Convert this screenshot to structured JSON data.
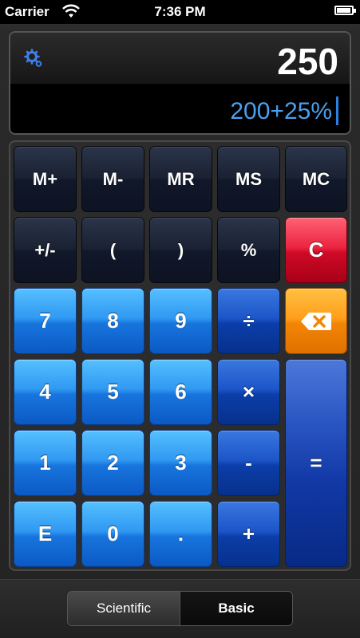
{
  "status_bar": {
    "carrier": "Carrier",
    "time": "7:36 PM",
    "wifi_icon": "wifi-icon",
    "battery_icon": "battery-icon",
    "battery_level": 0.95
  },
  "display": {
    "settings_icon": "gear-icon",
    "result": "250",
    "expression": "200+25%"
  },
  "keys": {
    "m_plus": "M+",
    "m_minus": "M-",
    "mr": "MR",
    "ms": "MS",
    "mc": "MC",
    "plus_minus": "+/-",
    "paren_open": "(",
    "paren_close": ")",
    "percent": "%",
    "clear": "C",
    "seven": "7",
    "eight": "8",
    "nine": "9",
    "divide": "÷",
    "backspace_icon": "backspace-icon",
    "four": "4",
    "five": "5",
    "six": "6",
    "multiply": "×",
    "equals": "=",
    "one": "1",
    "two": "2",
    "three": "3",
    "minus": "-",
    "exponent": "E",
    "zero": "0",
    "decimal": ".",
    "plus": "+"
  },
  "mode_switch": {
    "scientific_label": "Scientific",
    "basic_label": "Basic",
    "selected": "Basic"
  },
  "colors": {
    "number_key": "#2f98f2",
    "operator_key": "#1c55c8",
    "memory_key": "#1a2133",
    "clear_key": "#ec2541",
    "backspace_key": "#ff9e1b",
    "expression_text": "#4aa0ee"
  }
}
